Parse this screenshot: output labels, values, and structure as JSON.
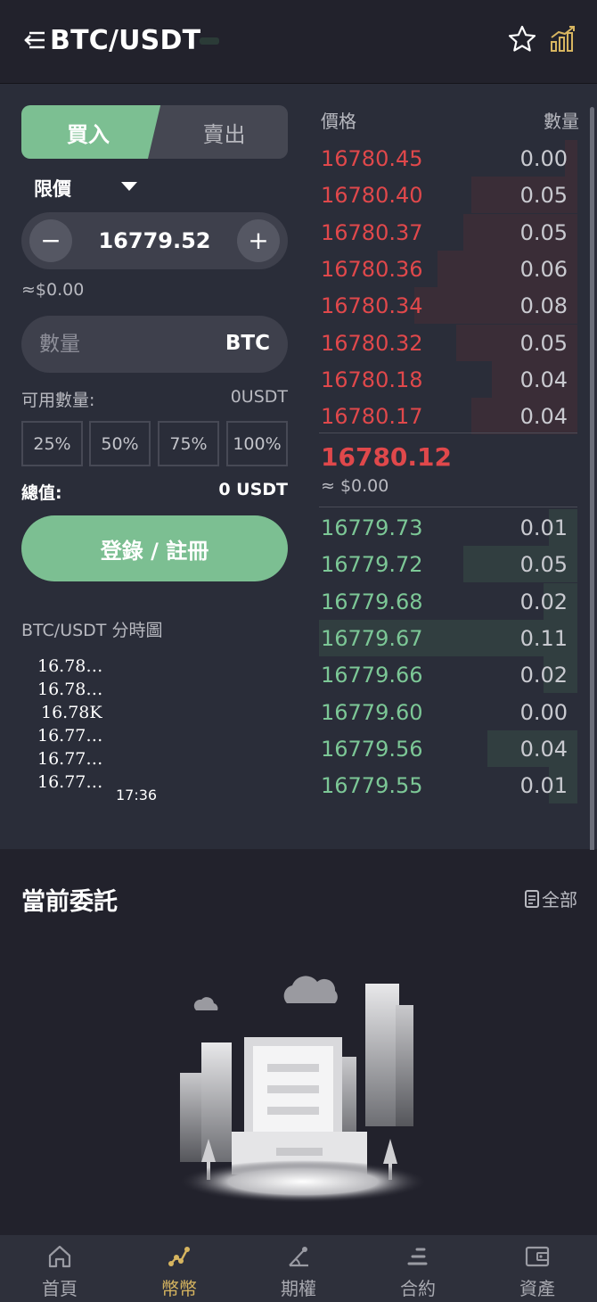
{
  "header": {
    "title": "BTC/USDT",
    "back_icon": "back-menu-icon",
    "favorite_icon": "star-icon",
    "chart_icon": "kline-chart-icon"
  },
  "trade_form": {
    "tab_buy": "買入",
    "tab_sell": "賣出",
    "order_type": "限價",
    "price_minus": "−",
    "price_value": "16779.52",
    "price_plus": "+",
    "price_approx": "≈$0.00",
    "qty_placeholder": "數量",
    "qty_unit": "BTC",
    "available_label": "可用數量:",
    "available_value": "0USDT",
    "percent_options": [
      "25%",
      "50%",
      "75%",
      "100%"
    ],
    "total_label": "總值:",
    "total_value": "0 USDT",
    "login_button": "登錄 / 註冊"
  },
  "mini_chart": {
    "title": "BTC/USDT 分時圖",
    "y_ticks": [
      "16.78…",
      "16.78…",
      "16.78K",
      "16.77…",
      "16.77…",
      "16.77…"
    ],
    "x_tick": "17:36"
  },
  "order_book": {
    "header_price": "價格",
    "header_qty": "數量",
    "asks": [
      {
        "price": "16780.45",
        "qty": "0.00",
        "depth": 0.05
      },
      {
        "price": "16780.40",
        "qty": "0.05",
        "depth": 0.41
      },
      {
        "price": "16780.37",
        "qty": "0.05",
        "depth": 0.44
      },
      {
        "price": "16780.36",
        "qty": "0.06",
        "depth": 0.54
      },
      {
        "price": "16780.34",
        "qty": "0.08",
        "depth": 0.63
      },
      {
        "price": "16780.32",
        "qty": "0.05",
        "depth": 0.47
      },
      {
        "price": "16780.18",
        "qty": "0.04",
        "depth": 0.33
      },
      {
        "price": "16780.17",
        "qty": "0.04",
        "depth": 0.41
      }
    ],
    "last_price": "16780.12",
    "last_approx": "≈ $0.00",
    "bids": [
      {
        "price": "16779.73",
        "qty": "0.01",
        "depth": 0.11
      },
      {
        "price": "16779.72",
        "qty": "0.05",
        "depth": 0.44
      },
      {
        "price": "16779.68",
        "qty": "0.02",
        "depth": 0.13
      },
      {
        "price": "16779.67",
        "qty": "0.11",
        "depth": 1.0
      },
      {
        "price": "16779.66",
        "qty": "0.02",
        "depth": 0.13
      },
      {
        "price": "16779.60",
        "qty": "0.00",
        "depth": 0.0
      },
      {
        "price": "16779.56",
        "qty": "0.04",
        "depth": 0.35
      },
      {
        "price": "16779.55",
        "qty": "0.01",
        "depth": 0.11
      }
    ]
  },
  "current_orders": {
    "title": "當前委託",
    "all_link": "全部",
    "all_icon": "document-list-icon",
    "empty_icon": "empty-city-illustration"
  },
  "bottom_nav": {
    "items": [
      {
        "label": "首頁",
        "icon": "home-icon",
        "active": false
      },
      {
        "label": "幣幣",
        "icon": "spot-trade-icon",
        "active": true
      },
      {
        "label": "期權",
        "icon": "options-icon",
        "active": false
      },
      {
        "label": "合約",
        "icon": "contract-icon",
        "active": false
      },
      {
        "label": "資產",
        "icon": "wallet-icon",
        "active": false
      }
    ]
  },
  "colors": {
    "buy_green": "#7cbf92",
    "sell_red": "#e0484b",
    "active_gold": "#d7b560",
    "background": "#2a2d39"
  }
}
